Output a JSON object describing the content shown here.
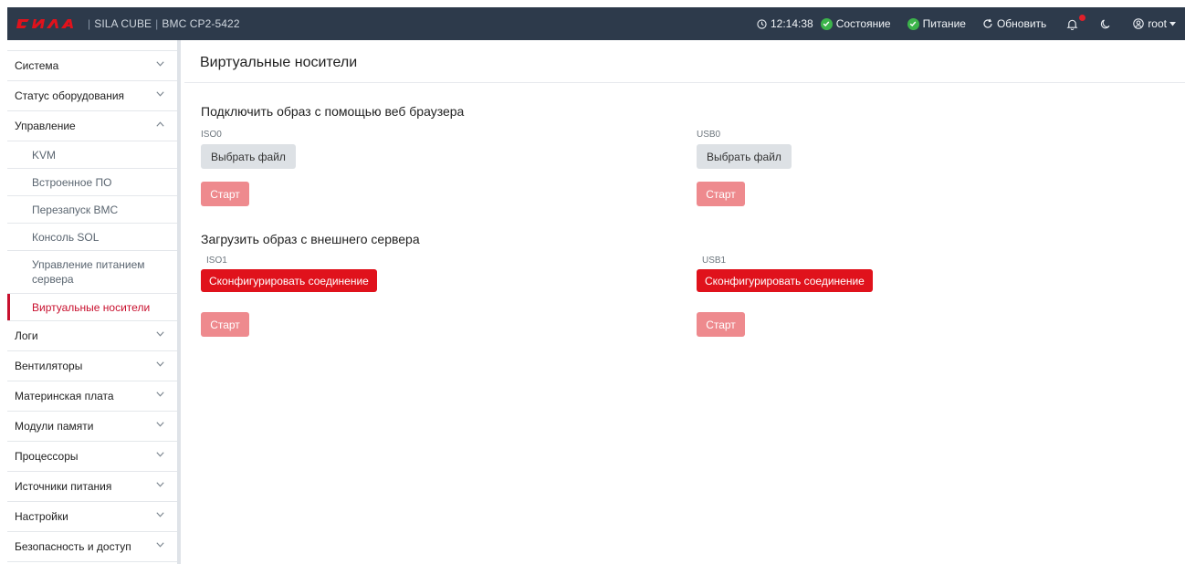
{
  "brand": {
    "logo_text": "СИЛА",
    "product": "SILA CUBE",
    "device": "BMC CP2-5422",
    "logo_color": "#e0121c"
  },
  "header": {
    "time": "12:14:38",
    "status_label": "Состояние",
    "power_label": "Питание",
    "refresh_label": "Обновить",
    "user_label": "root",
    "bar_color": "#2d3a4b",
    "ok_color": "#3cb44b"
  },
  "sidebar": {
    "items": [
      {
        "label": "Система"
      },
      {
        "label": "Статус оборудования"
      },
      {
        "label": "Управление",
        "expanded": true,
        "children": [
          {
            "label": "KVM"
          },
          {
            "label": "Встроенное ПО"
          },
          {
            "label": "Перезапуск BMC"
          },
          {
            "label": "Консоль SOL"
          },
          {
            "label": "Управление питанием сервера"
          },
          {
            "label": "Виртуальные носители",
            "active": true
          }
        ]
      },
      {
        "label": "Логи"
      },
      {
        "label": "Вентиляторы"
      },
      {
        "label": "Материнская плата"
      },
      {
        "label": "Модули памяти"
      },
      {
        "label": "Процессоры"
      },
      {
        "label": "Источники питания"
      },
      {
        "label": "Настройки"
      },
      {
        "label": "Безопасность и доступ"
      }
    ]
  },
  "main": {
    "title": "Виртуальные носители",
    "browser_section": {
      "title": "Подключить образ с помощью веб браузера",
      "devices": [
        {
          "name": "ISO0",
          "choose_label": "Выбрать файл",
          "start_label": "Старт"
        },
        {
          "name": "USB0",
          "choose_label": "Выбрать файл",
          "start_label": "Старт"
        }
      ]
    },
    "server_section": {
      "title": "Загрузить образ с внешнего сервера",
      "devices": [
        {
          "name": "ISO1",
          "configure_label": "Сконфигурировать соединение",
          "start_label": "Старт"
        },
        {
          "name": "USB1",
          "configure_label": "Сконфигурировать соединение",
          "start_label": "Старт"
        }
      ]
    },
    "accent_color": "#e0121c",
    "disabled_start_color": "#ee8a8e"
  }
}
